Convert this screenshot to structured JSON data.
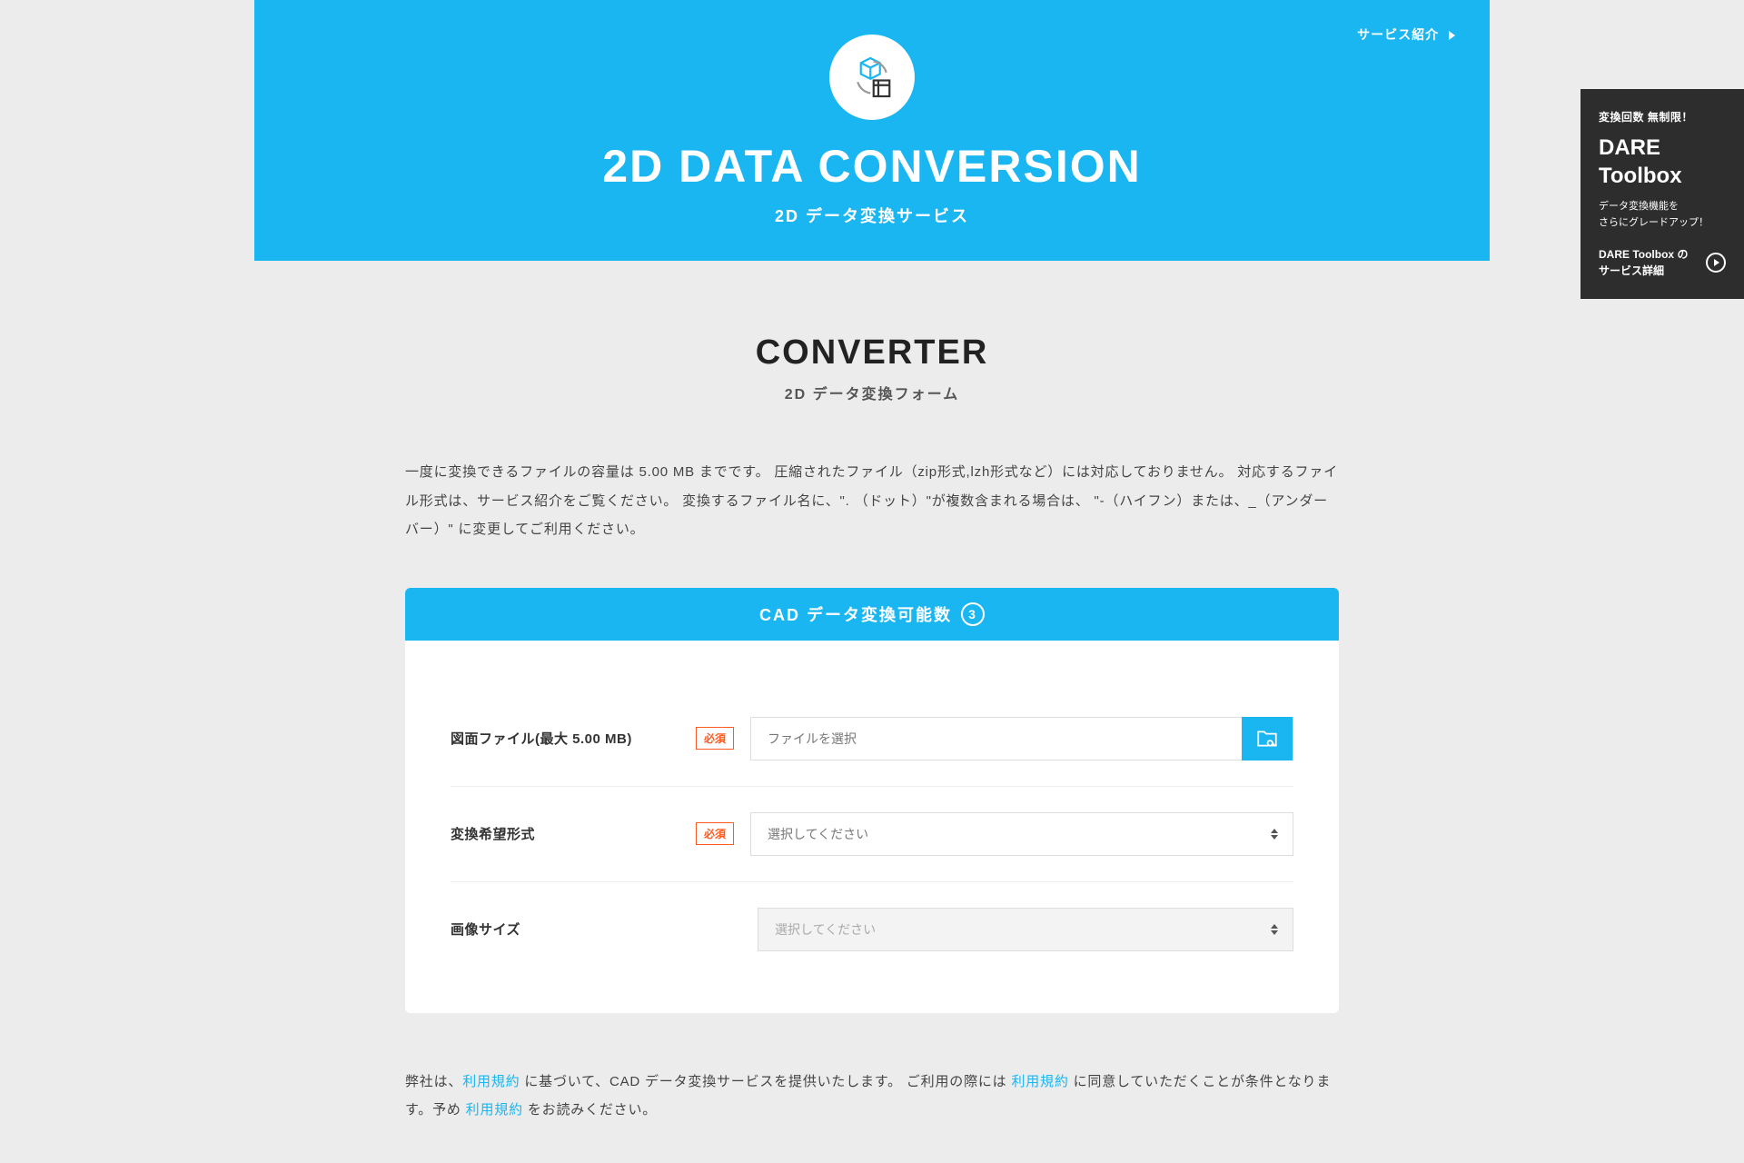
{
  "hero": {
    "nav_link": "サービス紹介",
    "title": "2D DATA CONVERSION",
    "subtitle": "2D データ変換サービス"
  },
  "converter": {
    "title": "CONVERTER",
    "subtitle": "2D データ変換フォーム",
    "description": "一度に変換できるファイルの容量は 5.00 MB までです。 圧縮されたファイル（zip形式,lzh形式など）には対応しておりません。 対応するファイル形式は、サービス紹介をご覧ください。 変換するファイル名に、\". （ドット）\"が複数含まれる場合は、 \"-（ハイフン）または、_（アンダーバー）\" に変更してご利用ください。"
  },
  "form": {
    "header": "CAD データ変換可能数",
    "count": "3",
    "required_label": "必須",
    "fields": {
      "file": {
        "label": "図面ファイル(最大 5.00 MB)",
        "placeholder": "ファイルを選択"
      },
      "format": {
        "label": "変換希望形式",
        "placeholder": "選択してください"
      },
      "size": {
        "label": "画像サイズ",
        "placeholder": "選択してください"
      }
    }
  },
  "footer": {
    "parts": {
      "p1": "弊社は、",
      "link1": "利用規約",
      "p2": " に基づいて、CAD データ変換サービスを提供いたします。 ご利用の際には ",
      "link2": "利用規約",
      "p3": " に同意していただくことが条件となります。予め ",
      "link3": "利用規約",
      "p4": " をお読みください。"
    }
  },
  "promo": {
    "tag": "変換回数 無制限！",
    "title_line1": "DARE",
    "title_line2": "Toolbox",
    "desc_line1": "データ変換機能を",
    "desc_line2": "さらにグレードアップ！",
    "link_line1": "DARE Toolbox の",
    "link_line2": "サービス詳細"
  }
}
